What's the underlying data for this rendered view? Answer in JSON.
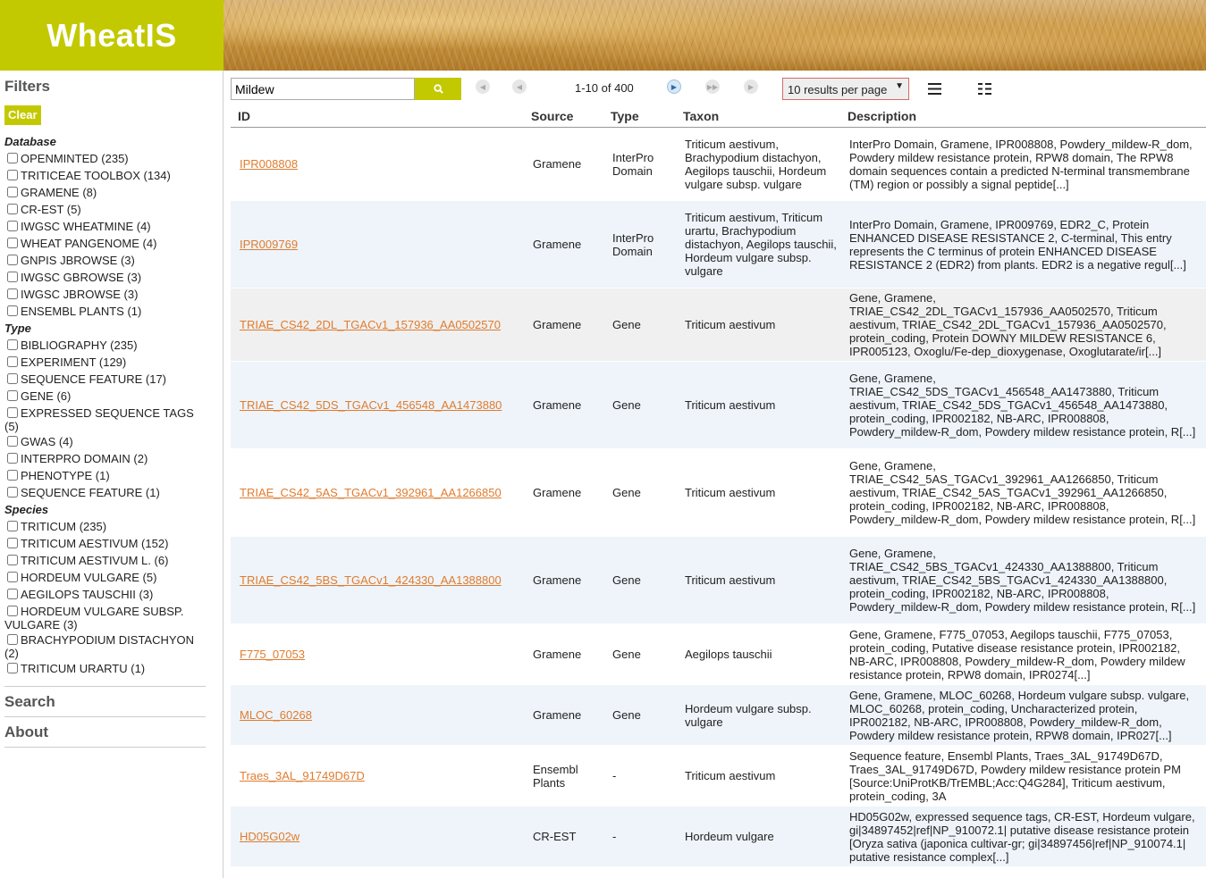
{
  "app": {
    "title": "WheatIS"
  },
  "sidebar": {
    "filters_heading": "Filters",
    "clear_label": "Clear",
    "groups": [
      {
        "title": "Database",
        "items": [
          "OPENMINTED (235)",
          "TRITICEAE TOOLBOX (134)",
          "GRAMENE (8)",
          "CR-EST (5)",
          "IWGSC WHEATMINE (4)",
          "WHEAT PANGENOME (4)",
          "GNPIS JBROWSE (3)",
          "IWGSC GBROWSE (3)",
          "IWGSC JBROWSE (3)",
          "ENSEMBL PLANTS (1)"
        ]
      },
      {
        "title": "Type",
        "items": [
          "BIBLIOGRAPHY (235)",
          "EXPERIMENT (129)",
          "SEQUENCE FEATURE (17)",
          "GENE (6)",
          "EXPRESSED SEQUENCE TAGS (5)",
          "GWAS (4)",
          "INTERPRO DOMAIN (2)",
          "PHENOTYPE (1)",
          "SEQUENCE FEATURE (1)"
        ]
      },
      {
        "title": "Species",
        "items": [
          "TRITICUM (235)",
          "TRITICUM AESTIVUM (152)",
          "TRITICUM AESTIVUM L. (6)",
          "HORDEUM VULGARE (5)",
          "AEGILOPS TAUSCHII (3)",
          "HORDEUM VULGARE SUBSP. VULGARE (3)",
          "BRACHYPODIUM DISTACHYON (2)",
          "TRITICUM URARTU (1)"
        ]
      }
    ],
    "search_heading": "Search",
    "about_heading": "About"
  },
  "toolbar": {
    "search_value": "Mildew",
    "page_info": "1-10 of 400",
    "per_page": "10 results per page"
  },
  "table": {
    "headers": {
      "id": "ID",
      "source": "Source",
      "type": "Type",
      "taxon": "Taxon",
      "description": "Description"
    },
    "rows": [
      {
        "id": "IPR008808",
        "source": "Gramene",
        "type": "InterPro Domain",
        "taxon": "Triticum aestivum, Brachypodium distachyon, Aegilops tauschii, Hordeum vulgare subsp. vulgare",
        "description": "InterPro Domain, Gramene, IPR008808, Powdery_mildew-R_dom, Powdery mildew resistance protein, RPW8 domain, The RPW8 domain sequences contain a predicted N-terminal transmembrane (TM) region or possibly a signal peptide[...]"
      },
      {
        "id": "IPR009769",
        "source": "Gramene",
        "type": "InterPro Domain",
        "taxon": "Triticum aestivum, Triticum urartu, Brachypodium distachyon, Aegilops tauschii, Hordeum vulgare subsp. vulgare",
        "description": "InterPro Domain, Gramene, IPR009769, EDR2_C, Protein ENHANCED DISEASE RESISTANCE 2, C-terminal, This entry represents the C terminus of protein ENHANCED DISEASE RESISTANCE 2 (EDR2) from plants. EDR2 is a negative regul[...]"
      },
      {
        "id": "TRIAE_CS42_2DL_TGACv1_157936_AA0502570",
        "source": "Gramene",
        "type": "Gene",
        "taxon": "Triticum aestivum",
        "description": "Gene, Gramene, TRIAE_CS42_2DL_TGACv1_157936_AA0502570, Triticum aestivum, TRIAE_CS42_2DL_TGACv1_157936_AA0502570, protein_coding, Protein DOWNY MILDEW RESISTANCE 6, IPR005123, Oxoglu/Fe-dep_dioxygenase, Oxoglutarate/ir[...]"
      },
      {
        "id": "TRIAE_CS42_5DS_TGACv1_456548_AA1473880",
        "source": "Gramene",
        "type": "Gene",
        "taxon": "Triticum aestivum",
        "description": "Gene, Gramene, TRIAE_CS42_5DS_TGACv1_456548_AA1473880, Triticum aestivum, TRIAE_CS42_5DS_TGACv1_456548_AA1473880, protein_coding, IPR002182, NB-ARC, IPR008808, Powdery_mildew-R_dom, Powdery mildew resistance protein, R[...]"
      },
      {
        "id": "TRIAE_CS42_5AS_TGACv1_392961_AA1266850",
        "source": "Gramene",
        "type": "Gene",
        "taxon": "Triticum aestivum",
        "description": "Gene, Gramene, TRIAE_CS42_5AS_TGACv1_392961_AA1266850, Triticum aestivum, TRIAE_CS42_5AS_TGACv1_392961_AA1266850, protein_coding, IPR002182, NB-ARC, IPR008808, Powdery_mildew-R_dom, Powdery mildew resistance protein, R[...]"
      },
      {
        "id": "TRIAE_CS42_5BS_TGACv1_424330_AA1388800",
        "source": "Gramene",
        "type": "Gene",
        "taxon": "Triticum aestivum",
        "description": "Gene, Gramene, TRIAE_CS42_5BS_TGACv1_424330_AA1388800, Triticum aestivum, TRIAE_CS42_5BS_TGACv1_424330_AA1388800, protein_coding, IPR002182, NB-ARC, IPR008808, Powdery_mildew-R_dom, Powdery mildew resistance protein, R[...]"
      },
      {
        "id": "F775_07053",
        "source": "Gramene",
        "type": "Gene",
        "taxon": "Aegilops tauschii",
        "description": "Gene, Gramene, F775_07053, Aegilops tauschii, F775_07053, protein_coding, Putative disease resistance protein, IPR002182, NB-ARC, IPR008808, Powdery_mildew-R_dom, Powdery mildew resistance protein, RPW8 domain, IPR0274[...]"
      },
      {
        "id": "MLOC_60268",
        "source": "Gramene",
        "type": "Gene",
        "taxon": "Hordeum vulgare subsp. vulgare",
        "description": "Gene, Gramene, MLOC_60268, Hordeum vulgare subsp. vulgare, MLOC_60268, protein_coding, Uncharacterized protein, IPR002182, NB-ARC, IPR008808, Powdery_mildew-R_dom, Powdery mildew resistance protein, RPW8 domain, IPR027[...]"
      },
      {
        "id": "Traes_3AL_91749D67D",
        "source": "Ensembl Plants",
        "type": "-",
        "taxon": "Triticum aestivum",
        "description": "Sequence feature, Ensembl Plants, Traes_3AL_91749D67D, Traes_3AL_91749D67D, Powdery mildew resistance protein PM [Source:UniProtKB/TrEMBL;Acc:Q4G284], Triticum aestivum, protein_coding, 3A"
      },
      {
        "id": "HD05G02w",
        "source": "CR-EST",
        "type": "-",
        "taxon": "Hordeum vulgare",
        "description": "HD05G02w, expressed sequence tags, CR-EST, Hordeum vulgare, gi|34897452|ref|NP_910072.1| putative disease resistance protein [Oryza sativa (japonica cultivar-gr; gi|34897456|ref|NP_910074.1| putative resistance complex[...]"
      }
    ]
  }
}
